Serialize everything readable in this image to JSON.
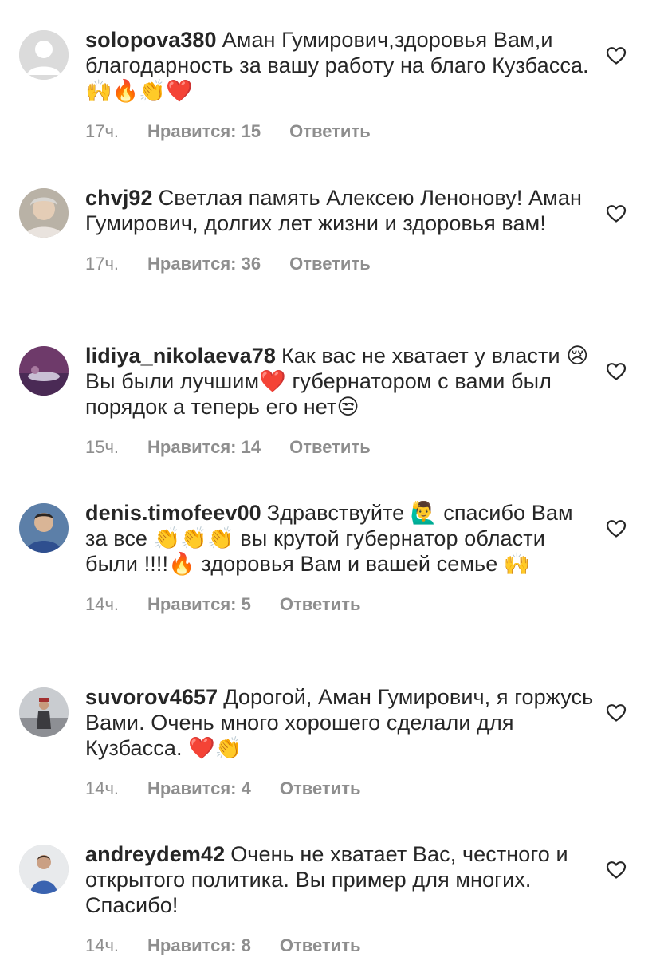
{
  "comments": [
    {
      "username": "solopova380",
      "text": "Аман Гумирович,здоровья Вам,и благодарность за вашу работу на благо Кузбасса.🙌🔥👏❤️",
      "time": "17ч.",
      "likes": "Нравится: 15",
      "reply": "Ответить",
      "avatar": "default-avatar-icon"
    },
    {
      "username": "chvj92",
      "text": "Светлая память Алексею Ленонову! Аман Гумирович, долгих лет жизни и здоровья вам!",
      "time": "17ч.",
      "likes": "Нравится: 36",
      "reply": "Ответить",
      "avatar": "user-photo"
    },
    {
      "username": "lidiya_nikolaeva78",
      "text": "Как вас не хватает у власти 😢Вы были лучшим❤️ губернатором с вами был порядок а теперь его нет😒",
      "time": "15ч.",
      "likes": "Нравится: 14",
      "reply": "Ответить",
      "avatar": "user-photo"
    },
    {
      "username": "denis.timofeev00",
      "text": "Здравствуйте 🙋‍♂️ спасибо Вам за все 👏👏👏 вы крутой губернатор области были !!!!🔥 здоровья Вам и вашей семье 🙌",
      "time": "14ч.",
      "likes": "Нравится: 5",
      "reply": "Ответить",
      "avatar": "user-photo"
    },
    {
      "username": "suvorov4657",
      "text": "Дорогой, Аман Гумирович, я горжусь Вами. Очень много хорошего сделали для Кузбасса. ❤️👏",
      "time": "14ч.",
      "likes": "Нравится: 4",
      "reply": "Ответить",
      "avatar": "user-photo"
    },
    {
      "username": "andreydem42",
      "text": "Очень не хватает Вас, честного и открытого политика. Вы пример для многих. Спасибо!",
      "time": "14ч.",
      "likes": "Нравится: 8",
      "reply": "Ответить",
      "avatar": "user-photo"
    }
  ],
  "colors": {
    "text": "#262626",
    "meta": "#8e8e8e",
    "heart_outline": "#262626"
  },
  "icons": {
    "like": "heart-outline-icon"
  }
}
